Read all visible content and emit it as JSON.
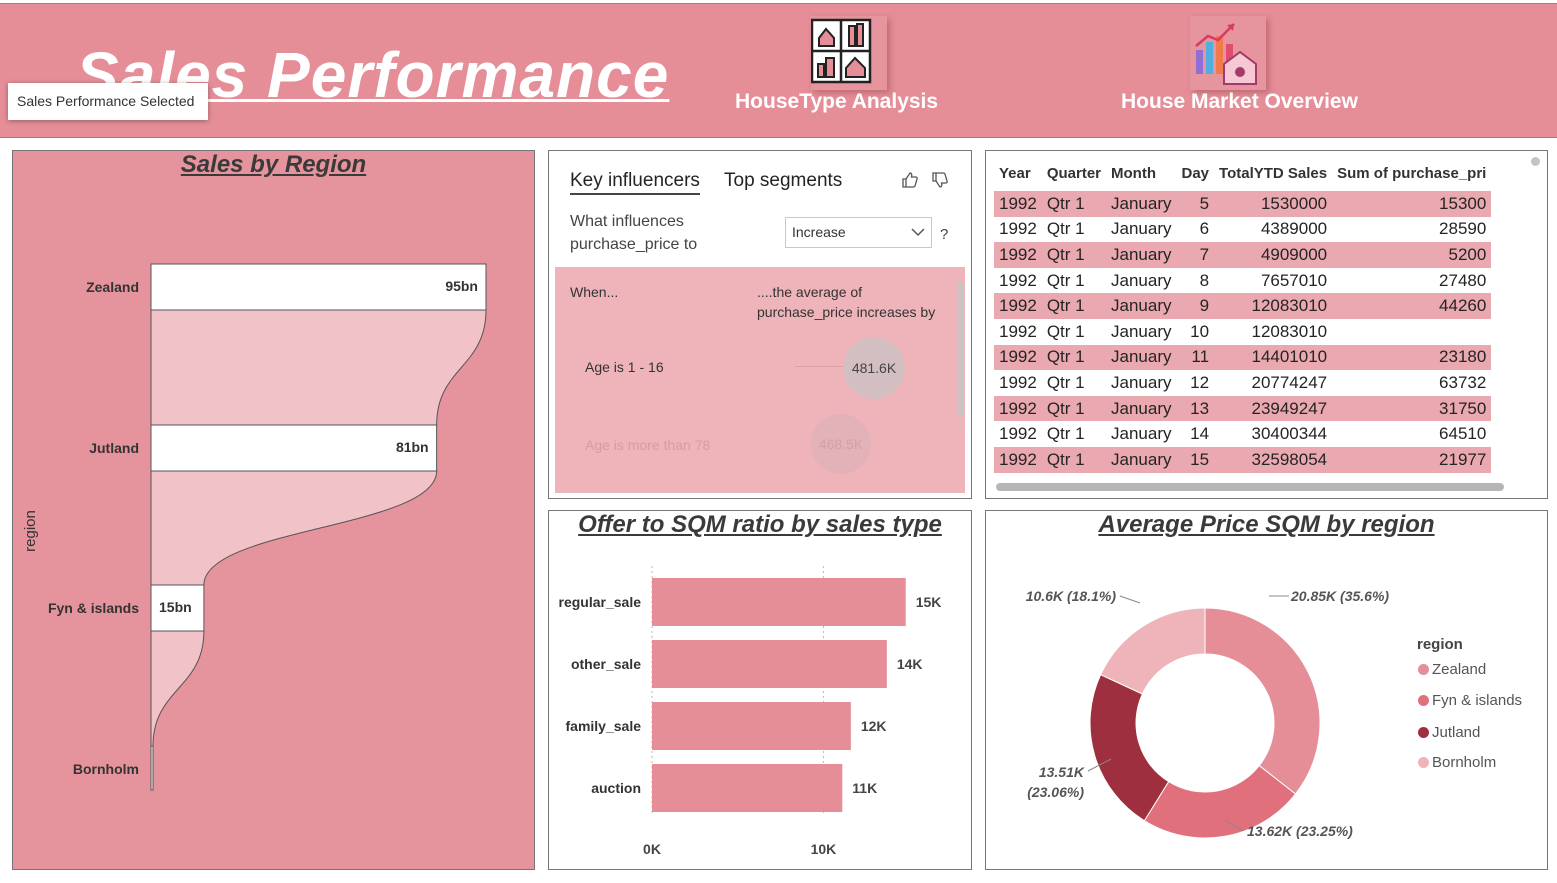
{
  "header": {
    "title": "Sales Performance",
    "tooltip": "Sales Performance Selected",
    "nav": [
      {
        "label": "HouseType Analysis",
        "icon": "house-grid-icon"
      },
      {
        "label": "House Market Overview",
        "icon": "house-market-chart-icon"
      }
    ]
  },
  "colors": {
    "header_bg": "#e58e98",
    "panel_pink": "#e5939c",
    "bar_pink": "#e58e98",
    "zealand": "#e58e98",
    "fyn": "#e0707c",
    "jutland": "#9e2f3e",
    "bornholm": "#efb4ba"
  },
  "key_influencers": {
    "tabs": [
      "Key influencers",
      "Top segments"
    ],
    "question_line1": "What influences",
    "question_line2": "purchase_price to",
    "dropdown_value": "Increase",
    "help": "?",
    "when_label": "When...",
    "effect_label_line1": "....the average of",
    "effect_label_line2": "purchase_price increases by",
    "rows": [
      {
        "label": "Age is 1 - 16",
        "value": "481.6K"
      },
      {
        "label": "Age is more than 78",
        "value": "468.5K"
      }
    ]
  },
  "table": {
    "columns": [
      "Year",
      "Quarter",
      "Month",
      "Day",
      "TotalYTD Sales",
      "Sum of purchase_pri"
    ],
    "rows": [
      [
        "1992",
        "Qtr 1",
        "January",
        "5",
        "1530000",
        "15300"
      ],
      [
        "1992",
        "Qtr 1",
        "January",
        "6",
        "4389000",
        "28590"
      ],
      [
        "1992",
        "Qtr 1",
        "January",
        "7",
        "4909000",
        "5200"
      ],
      [
        "1992",
        "Qtr 1",
        "January",
        "8",
        "7657010",
        "27480"
      ],
      [
        "1992",
        "Qtr 1",
        "January",
        "9",
        "12083010",
        "44260"
      ],
      [
        "1992",
        "Qtr 1",
        "January",
        "10",
        "12083010",
        ""
      ],
      [
        "1992",
        "Qtr 1",
        "January",
        "11",
        "14401010",
        "23180"
      ],
      [
        "1992",
        "Qtr 1",
        "January",
        "12",
        "20774247",
        "63732"
      ],
      [
        "1992",
        "Qtr 1",
        "January",
        "13",
        "23949247",
        "31750"
      ],
      [
        "1992",
        "Qtr 1",
        "January",
        "14",
        "30400344",
        "64510"
      ],
      [
        "1992",
        "Qtr 1",
        "January",
        "15",
        "32598054",
        "21977"
      ]
    ]
  },
  "chart_data": [
    {
      "type": "funnel",
      "title": "Sales by Region",
      "ylabel": "region",
      "categories": [
        "Zealand",
        "Jutland",
        "Fyn & islands",
        "Bornholm"
      ],
      "values": [
        95,
        81,
        15,
        0.2
      ],
      "labels": [
        "95bn",
        "81bn",
        "15bn",
        ""
      ],
      "unit": "bn"
    },
    {
      "type": "bar",
      "orientation": "horizontal",
      "title": "Offer to SQM ratio by sales type",
      "categories": [
        "regular_sale",
        "other_sale",
        "family_sale",
        "auction"
      ],
      "values": [
        14800,
        13700,
        11600,
        11100
      ],
      "labels": [
        "15K",
        "14K",
        "12K",
        "11K"
      ],
      "xticks": [
        "0K",
        "10K"
      ],
      "xlim": [
        0,
        17500
      ]
    },
    {
      "type": "pie",
      "donut": true,
      "title": "Average Price SQM by region",
      "legend_title": "region",
      "legend_position": "right",
      "categories": [
        "Zealand",
        "Fyn & islands",
        "Jutland",
        "Bornholm"
      ],
      "values": [
        20.85,
        13.62,
        13.51,
        10.6
      ],
      "labels": [
        "20.85K (35.6%)",
        "13.62K (23.25%)",
        "13.51K (23.06%)",
        "10.6K (18.1%)"
      ]
    }
  ]
}
